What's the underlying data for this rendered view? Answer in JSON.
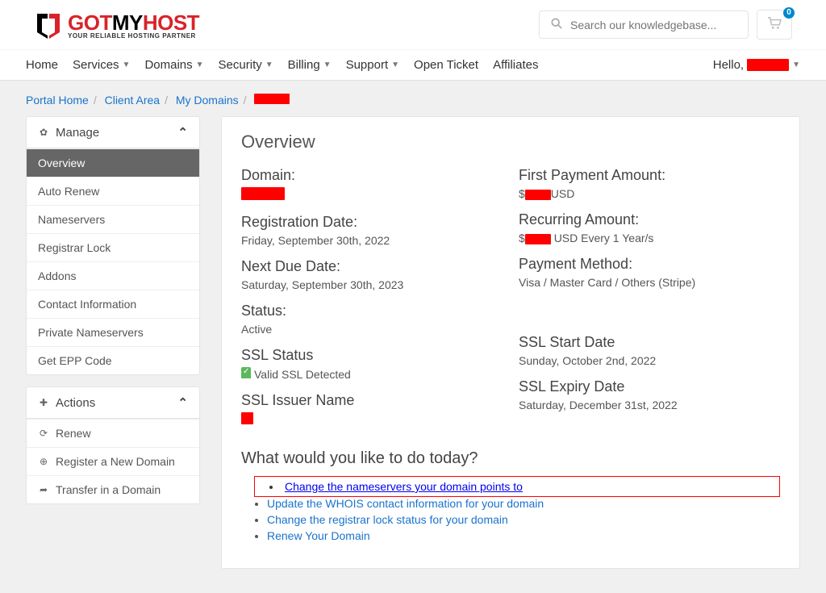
{
  "brand": {
    "got": "GOT",
    "my": "MY",
    "host": "HOST",
    "tagline": "YOUR RELIABLE HOSTING PARTNER"
  },
  "search": {
    "placeholder": "Search our knowledgebase..."
  },
  "cart_badge": "0",
  "nav": {
    "items": [
      "Home",
      "Services",
      "Domains",
      "Security",
      "Billing",
      "Support",
      "Open Ticket",
      "Affiliates"
    ],
    "has_caret": [
      false,
      true,
      true,
      true,
      true,
      true,
      false,
      false
    ],
    "hello": "Hello, "
  },
  "breadcrumb": {
    "items": [
      "Portal Home",
      "Client Area",
      "My Domains"
    ]
  },
  "sidebar": {
    "manage_title": "Manage",
    "manage_items": [
      "Overview",
      "Auto Renew",
      "Nameservers",
      "Registrar Lock",
      "Addons",
      "Contact Information",
      "Private Nameservers",
      "Get EPP Code"
    ],
    "actions_title": "Actions",
    "actions_items": [
      "Renew",
      "Register a New Domain",
      "Transfer in a Domain"
    ]
  },
  "overview": {
    "title": "Overview",
    "left": {
      "domain_lbl": "Domain:",
      "reg_lbl": "Registration Date:",
      "reg_val": "Friday, September 30th, 2022",
      "due_lbl": "Next Due Date:",
      "due_val": "Saturday, September 30th, 2023",
      "status_lbl": "Status:",
      "status_val": "Active",
      "sslstat_lbl": "SSL Status",
      "sslstat_val": "Valid SSL Detected",
      "sslissuer_lbl": "SSL Issuer Name"
    },
    "right": {
      "first_lbl": "First Payment Amount:",
      "first_val_suffix": "USD",
      "recur_lbl": "Recurring Amount:",
      "recur_val_suffix": "USD Every 1 Year/s",
      "pay_lbl": "Payment Method:",
      "pay_val": "Visa / Master Card / Others (Stripe)",
      "sslstart_lbl": "SSL Start Date",
      "sslstart_val": "Sunday, October 2nd, 2022",
      "sslexp_lbl": "SSL Expiry Date",
      "sslexp_val": "Saturday, December 31st, 2022"
    },
    "todo_hdr": "What would you like to do today?",
    "todo": [
      "Change the nameservers your domain points to",
      "Update the WHOIS contact information for your domain",
      "Change the registrar lock status for your domain",
      "Renew Your Domain"
    ]
  }
}
